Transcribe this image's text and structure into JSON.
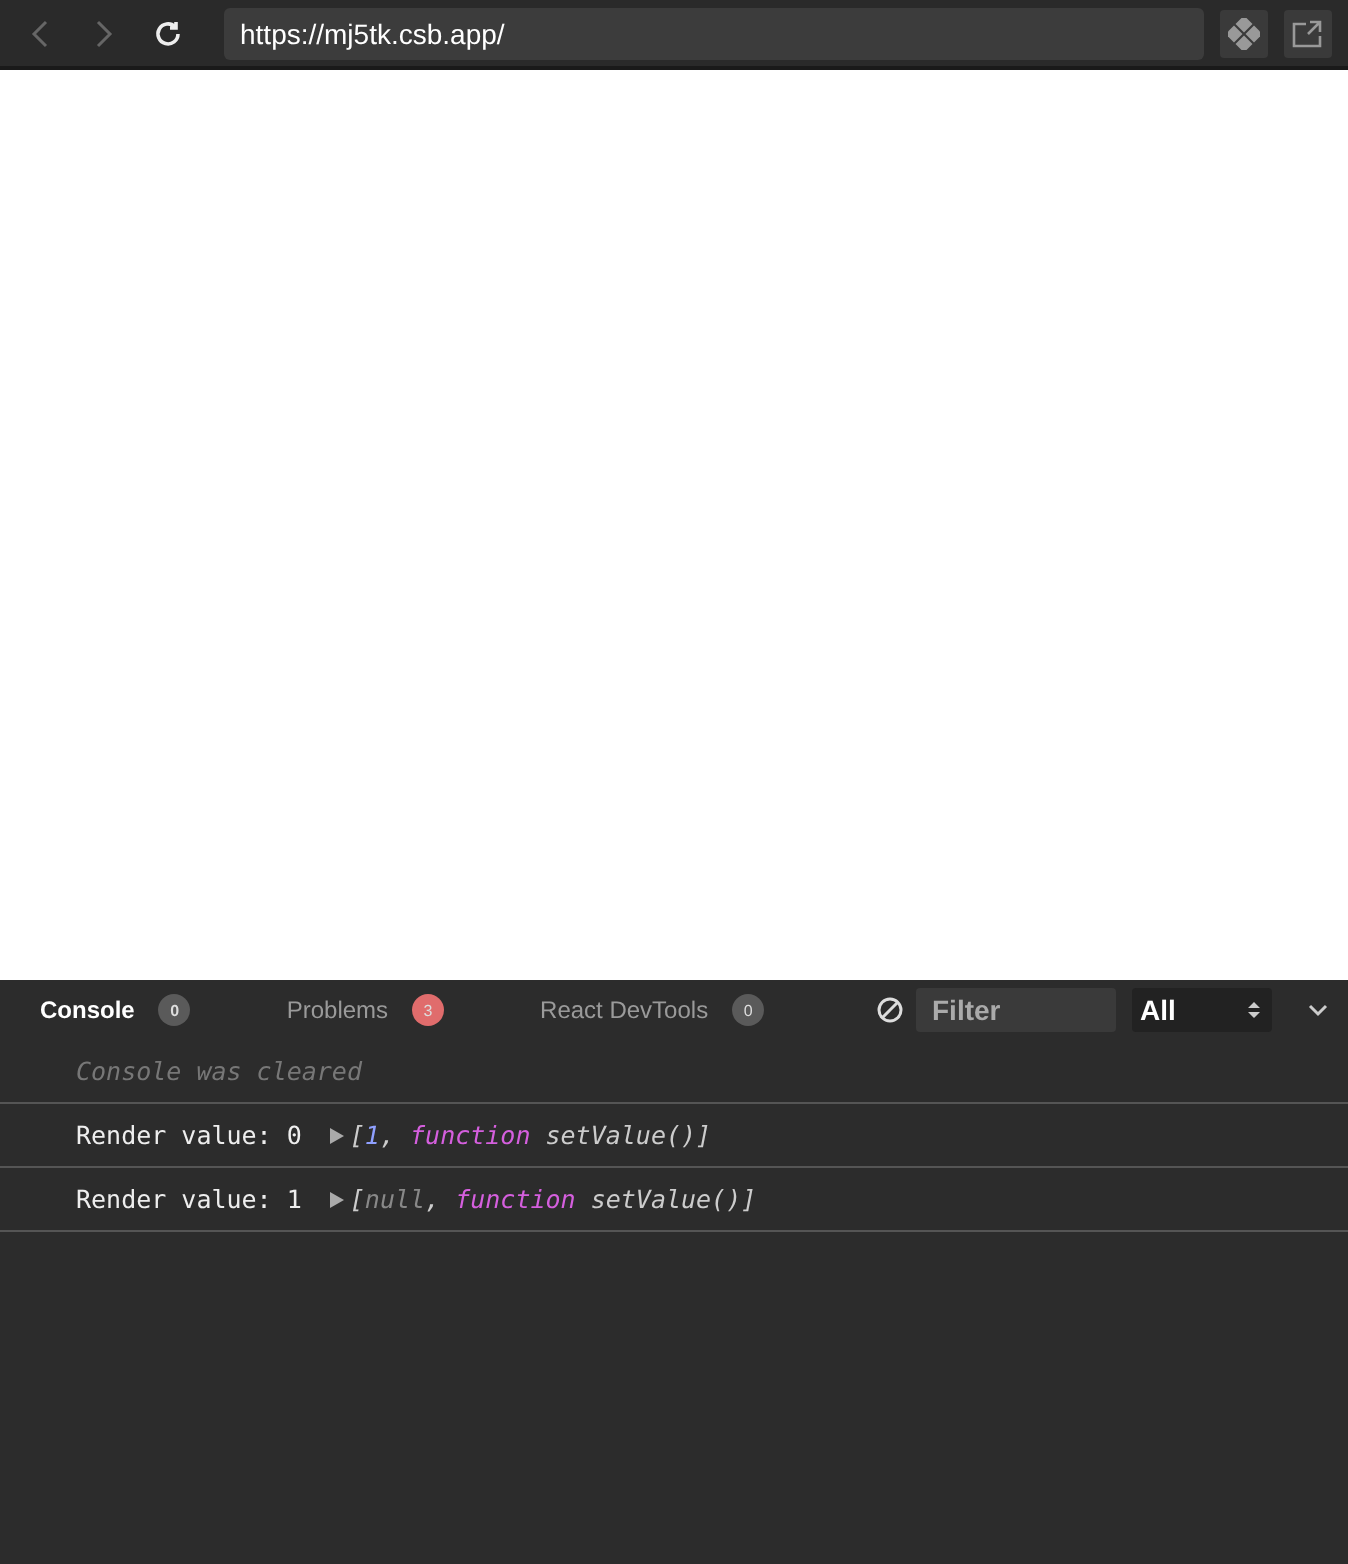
{
  "browser": {
    "url": "https://mj5tk.csb.app/"
  },
  "devtools": {
    "tabs": [
      {
        "label": "Console",
        "count": "0",
        "color": "#5a5a5a",
        "selected": true
      },
      {
        "label": "Problems",
        "count": "3",
        "color": "#e06c6c",
        "selected": false
      },
      {
        "label": "React DevTools",
        "count": "0",
        "color": "#5a5a5a",
        "selected": false
      }
    ],
    "filter": {
      "placeholder": "Filter"
    },
    "level": {
      "value": "All"
    },
    "notice": "Console was cleared",
    "logs": [
      {
        "message": "Render value: 0",
        "tokens": [
          {
            "kind": "punct",
            "text": "["
          },
          {
            "kind": "number",
            "text": "1"
          },
          {
            "kind": "punct",
            "text": ", "
          },
          {
            "kind": "keyword",
            "text": "function"
          },
          {
            "kind": "plain",
            "text": " setValue()]"
          }
        ]
      },
      {
        "message": "Render value: 1",
        "tokens": [
          {
            "kind": "punct",
            "text": "["
          },
          {
            "kind": "null",
            "text": "null"
          },
          {
            "kind": "punct",
            "text": ", "
          },
          {
            "kind": "keyword",
            "text": "function"
          },
          {
            "kind": "plain",
            "text": " setValue()]"
          }
        ]
      }
    ]
  }
}
